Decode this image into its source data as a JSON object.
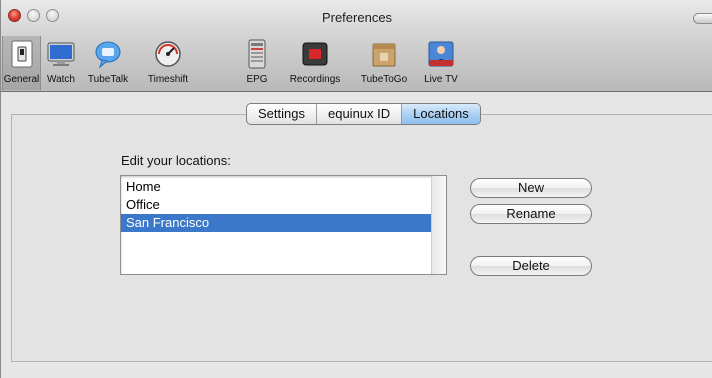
{
  "window": {
    "title": "Preferences"
  },
  "toolbar": {
    "items": [
      {
        "label": "General",
        "icon": "light-switch-icon",
        "selected": true
      },
      {
        "label": "Watch",
        "icon": "monitor-icon"
      },
      {
        "label": "TubeTalk",
        "icon": "chat-bubble-icon"
      },
      {
        "label": "Timeshift",
        "icon": "gauge-icon"
      },
      {
        "label": "EPG",
        "icon": "tv-guide-icon"
      },
      {
        "label": "Recordings",
        "icon": "record-icon"
      },
      {
        "label": "TubeToGo",
        "icon": "box-icon"
      },
      {
        "label": "Live TV",
        "icon": "live-tv-icon"
      }
    ]
  },
  "tabs": {
    "items": [
      "Settings",
      "equinux ID",
      "Locations"
    ],
    "active": "Locations"
  },
  "locations": {
    "label": "Edit your locations:",
    "items": [
      "Home",
      "Office",
      "San Francisco"
    ],
    "selected": "San Francisco"
  },
  "buttons": {
    "new": "New",
    "rename": "Rename",
    "delete": "Delete"
  },
  "colors": {
    "selection": "#3b78c9",
    "active_tab": "#a9cff3",
    "close_button": "#e2453a"
  }
}
